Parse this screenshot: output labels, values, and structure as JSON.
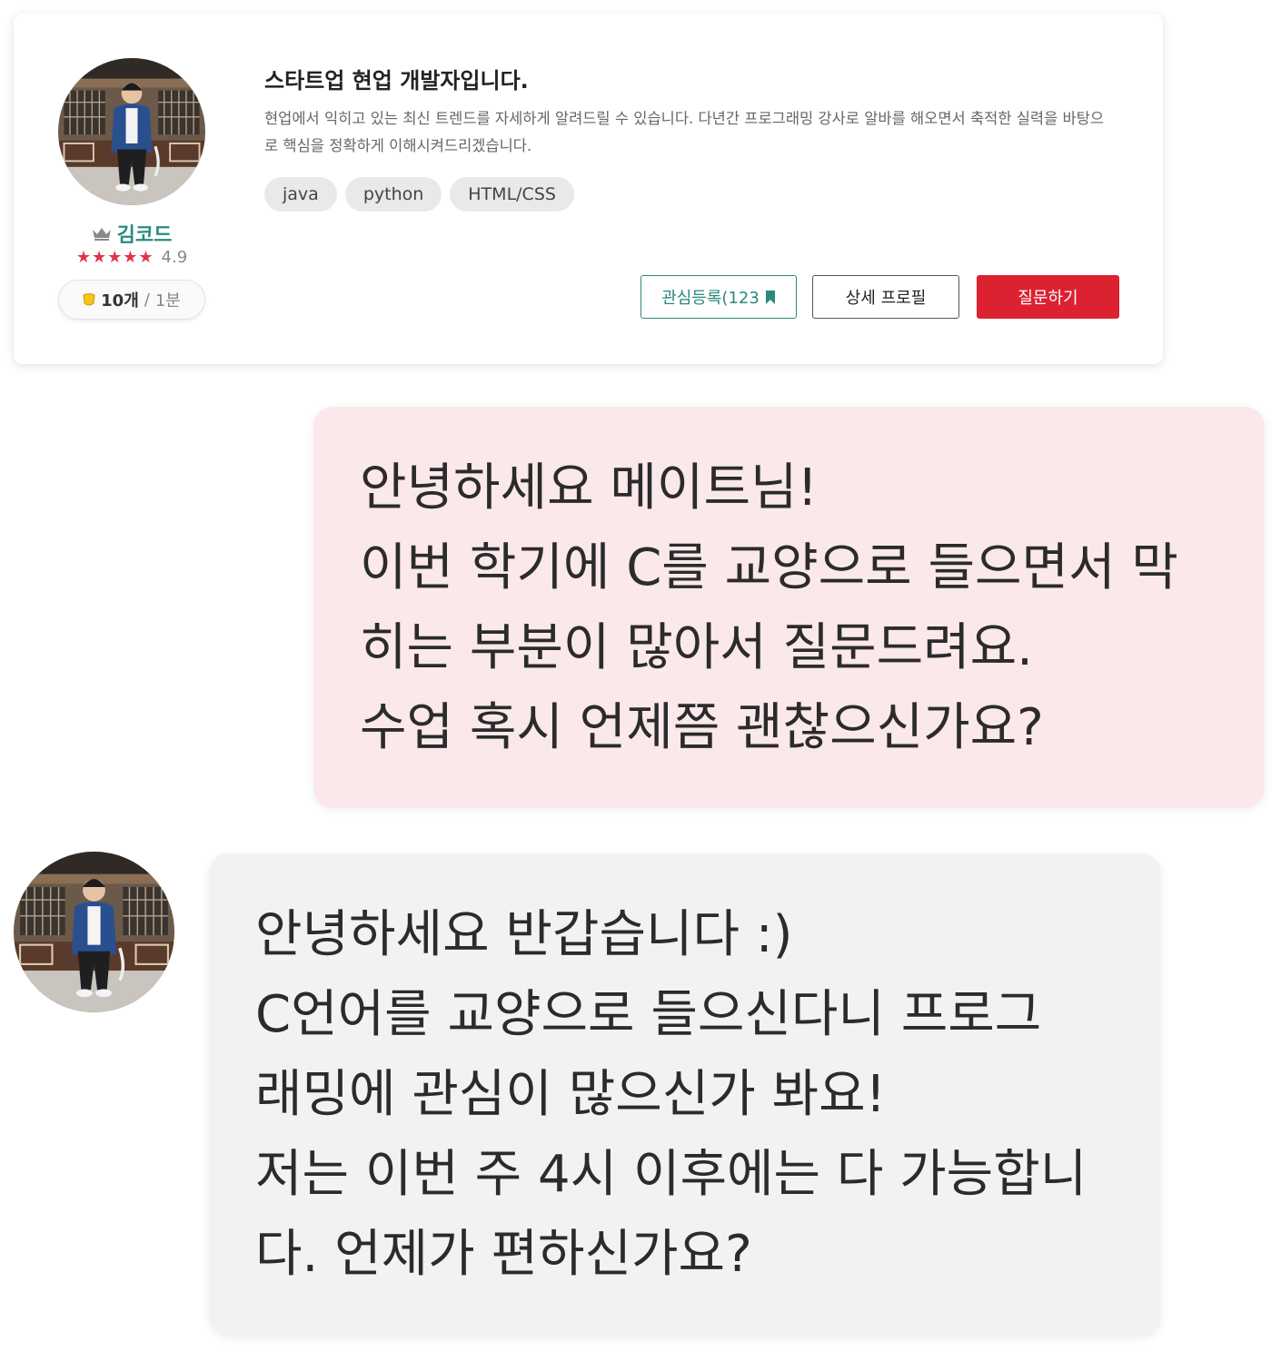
{
  "profile": {
    "name": "김코드",
    "rating": "4.9",
    "stars": "★★★★★",
    "answer_count": "10개",
    "separator": "/",
    "response_time": "1분",
    "headline": "스타트업 현업 개발자입니다.",
    "description": "현업에서 익히고 있는 최신 트렌드를 자세하게 알려드릴 수 있습니다. 다년간 프로그래밍 강사로 알바를 해오면서 축적한 실력을 바탕으로 핵심을 정확하게 이해시켜드리겠습니다.",
    "tags": [
      "java",
      "python",
      "HTML/CSS"
    ],
    "follow_label": "관심등록(123",
    "detail_label": "상세 프로필",
    "ask_label": "질문하기"
  },
  "colors": {
    "accent_green": "#2a8a7e",
    "ask_red": "#dc2131",
    "star_red": "#e0344b",
    "sent_bubble": "#fae8ea",
    "received_bubble": "#f2f2f2"
  },
  "icons": {
    "crown": "crown-icon",
    "coin": "coin-icon",
    "bookmark": "bookmark-icon"
  },
  "messages": [
    {
      "sender": "me",
      "lines": [
        "안녕하세요 메이트님!",
        "이번 학기에 C를 교양으로 들으면서 막",
        "히는 부분이 많아서 질문드려요.",
        "수업 혹시 언제쯤 괜찮으신가요?"
      ]
    },
    {
      "sender": "mentor",
      "lines": [
        "안녕하세요 반갑습니다 :)",
        "C언어를 교양으로 들으신다니 프로그",
        "래밍에 관심이 많으신가 봐요!",
        "저는 이번 주 4시 이후에는 다 가능합니",
        "다. 언제가 편하신가요?"
      ]
    }
  ]
}
